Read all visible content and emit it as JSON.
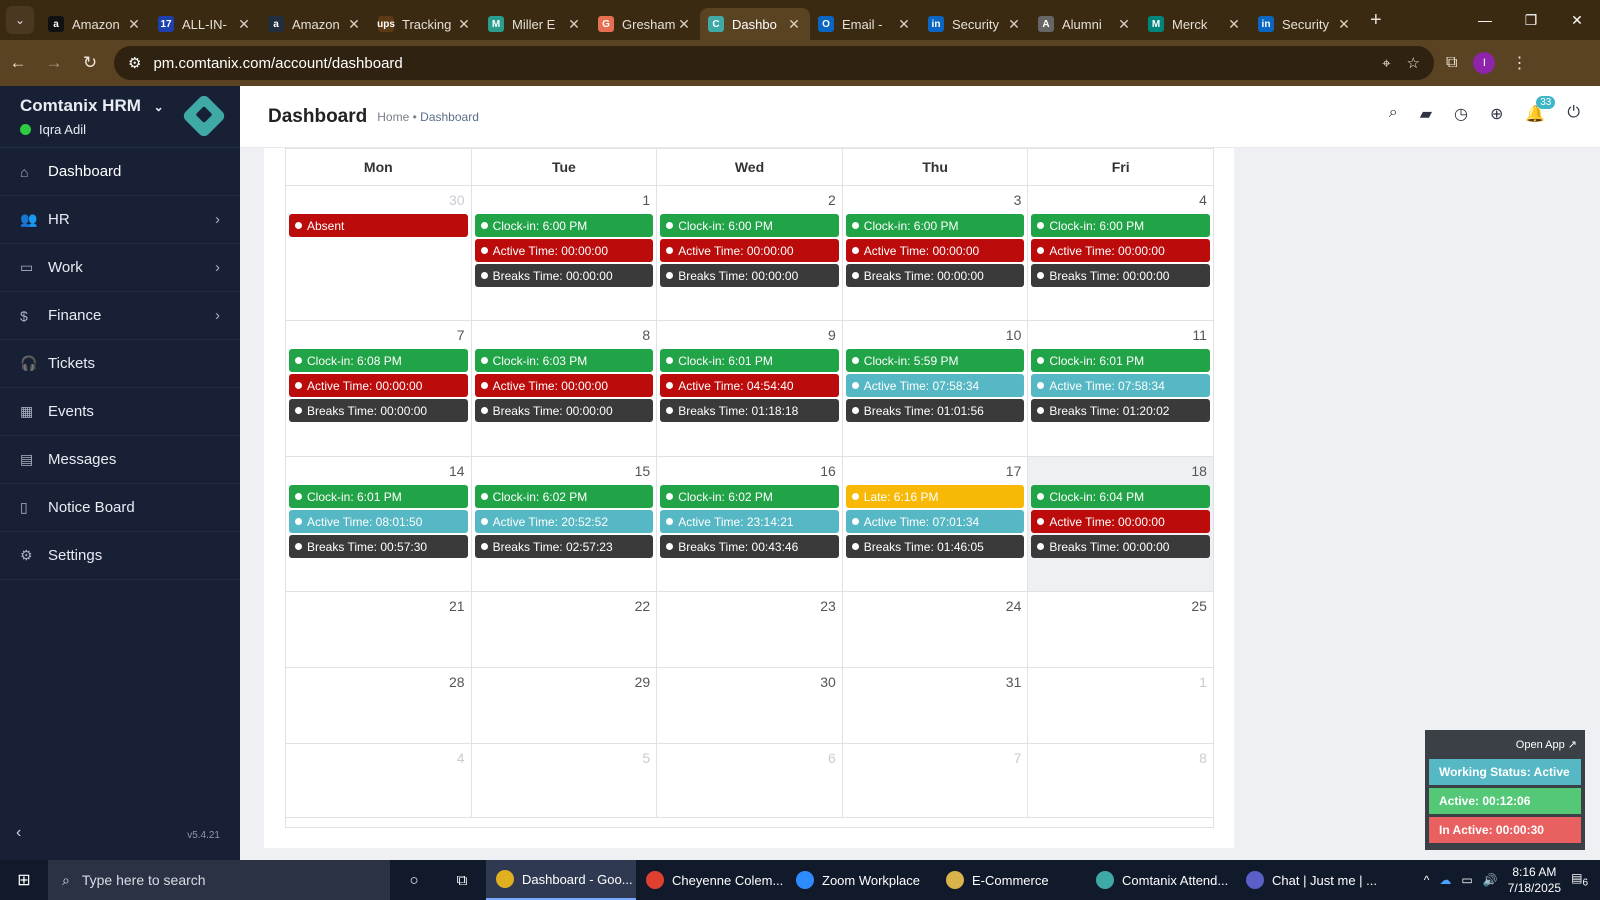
{
  "browser": {
    "tabs": [
      {
        "title": "Amazon",
        "color": "#111111",
        "glyph": "a"
      },
      {
        "title": "ALL-IN-",
        "color": "#1e40af",
        "glyph": "17"
      },
      {
        "title": "Amazon",
        "color": "#232f3e",
        "glyph": "a"
      },
      {
        "title": "Tracking",
        "color": "#5b3a16",
        "glyph": "ups"
      },
      {
        "title": "Miller E",
        "color": "#2a9d8f",
        "glyph": "M"
      },
      {
        "title": "Gresham",
        "color": "#e76f51",
        "glyph": "G"
      },
      {
        "title": "Dashbo",
        "color": "#3fa9a6",
        "glyph": "C"
      },
      {
        "title": "Email -",
        "color": "#0a66c2",
        "glyph": "O"
      },
      {
        "title": "Security",
        "color": "#0a66c2",
        "glyph": "in"
      },
      {
        "title": "Alumni",
        "color": "#666666",
        "glyph": "A"
      },
      {
        "title": "Merck",
        "color": "#00857c",
        "glyph": "M"
      },
      {
        "title": "Security",
        "color": "#0a66c2",
        "glyph": "in"
      }
    ],
    "active_tab_index": 6,
    "url": "pm.comtanix.com/account/dashboard",
    "profile_initial": "I"
  },
  "sidebar": {
    "brand": "Comtanix HRM",
    "user": "Iqra Adil",
    "items": [
      {
        "label": "Dashboard",
        "icon": "⌂",
        "has_children": false
      },
      {
        "label": "HR",
        "icon": "👥",
        "has_children": true
      },
      {
        "label": "Work",
        "icon": "▭",
        "has_children": true
      },
      {
        "label": "Finance",
        "icon": "$",
        "has_children": true
      },
      {
        "label": "Tickets",
        "icon": "🎧",
        "has_children": false
      },
      {
        "label": "Events",
        "icon": "▦",
        "has_children": false
      },
      {
        "label": "Messages",
        "icon": "▤",
        "has_children": false
      },
      {
        "label": "Notice Board",
        "icon": "▯",
        "has_children": false
      },
      {
        "label": "Settings",
        "icon": "⚙",
        "has_children": false
      }
    ],
    "version": "v5.4.21"
  },
  "header": {
    "title": "Dashboard",
    "breadcrumb_home": "Home",
    "breadcrumb_sep": "•",
    "breadcrumb_current": "Dashboard",
    "notification_count": "33"
  },
  "calendar": {
    "weekdays": [
      "Mon",
      "Tue",
      "Wed",
      "Thu",
      "Fri"
    ],
    "weeks": [
      {
        "height": 135,
        "days": [
          {
            "num": "30",
            "muted": true,
            "events": [
              {
                "type": "red",
                "text": "Absent"
              }
            ]
          },
          {
            "num": "1",
            "events": [
              {
                "type": "green",
                "text": "Clock-in: 6:00 PM"
              },
              {
                "type": "red",
                "text": "Active Time: 00:00:00"
              },
              {
                "type": "dark",
                "text": "Breaks Time: 00:00:00"
              }
            ]
          },
          {
            "num": "2",
            "events": [
              {
                "type": "green",
                "text": "Clock-in: 6:00 PM"
              },
              {
                "type": "red",
                "text": "Active Time: 00:00:00"
              },
              {
                "type": "dark",
                "text": "Breaks Time: 00:00:00"
              }
            ]
          },
          {
            "num": "3",
            "events": [
              {
                "type": "green",
                "text": "Clock-in: 6:00 PM"
              },
              {
                "type": "red",
                "text": "Active Time: 00:00:00"
              },
              {
                "type": "dark",
                "text": "Breaks Time: 00:00:00"
              }
            ]
          },
          {
            "num": "4",
            "events": [
              {
                "type": "green",
                "text": "Clock-in: 6:00 PM"
              },
              {
                "type": "red",
                "text": "Active Time: 00:00:00"
              },
              {
                "type": "dark",
                "text": "Breaks Time: 00:00:00"
              }
            ]
          }
        ]
      },
      {
        "height": 136,
        "days": [
          {
            "num": "7",
            "events": [
              {
                "type": "green",
                "text": "Clock-in: 6:08 PM"
              },
              {
                "type": "red",
                "text": "Active Time: 00:00:00"
              },
              {
                "type": "dark",
                "text": "Breaks Time: 00:00:00"
              }
            ]
          },
          {
            "num": "8",
            "events": [
              {
                "type": "green",
                "text": "Clock-in: 6:03 PM"
              },
              {
                "type": "red",
                "text": "Active Time: 00:00:00"
              },
              {
                "type": "dark",
                "text": "Breaks Time: 00:00:00"
              }
            ]
          },
          {
            "num": "9",
            "events": [
              {
                "type": "green",
                "text": "Clock-in: 6:01 PM"
              },
              {
                "type": "red",
                "text": "Active Time: 04:54:40"
              },
              {
                "type": "dark",
                "text": "Breaks Time: 01:18:18"
              }
            ]
          },
          {
            "num": "10",
            "events": [
              {
                "type": "green",
                "text": "Clock-in: 5:59 PM"
              },
              {
                "type": "teal",
                "text": "Active Time: 07:58:34"
              },
              {
                "type": "dark",
                "text": "Breaks Time: 01:01:56"
              }
            ]
          },
          {
            "num": "11",
            "events": [
              {
                "type": "green",
                "text": "Clock-in: 6:01 PM"
              },
              {
                "type": "teal",
                "text": "Active Time: 07:58:34"
              },
              {
                "type": "dark",
                "text": "Breaks Time: 01:20:02"
              }
            ]
          }
        ]
      },
      {
        "height": 135,
        "days": [
          {
            "num": "14",
            "events": [
              {
                "type": "green",
                "text": "Clock-in: 6:01 PM"
              },
              {
                "type": "teal",
                "text": "Active Time: 08:01:50"
              },
              {
                "type": "dark",
                "text": "Breaks Time: 00:57:30"
              }
            ]
          },
          {
            "num": "15",
            "events": [
              {
                "type": "green",
                "text": "Clock-in: 6:02 PM"
              },
              {
                "type": "teal",
                "text": "Active Time: 20:52:52"
              },
              {
                "type": "dark",
                "text": "Breaks Time: 02:57:23"
              }
            ]
          },
          {
            "num": "16",
            "events": [
              {
                "type": "green",
                "text": "Clock-in: 6:02 PM"
              },
              {
                "type": "teal",
                "text": "Active Time: 23:14:21"
              },
              {
                "type": "dark",
                "text": "Breaks Time: 00:43:46"
              }
            ]
          },
          {
            "num": "17",
            "events": [
              {
                "type": "yellow",
                "text": "Late: 6:16 PM"
              },
              {
                "type": "teal",
                "text": "Active Time: 07:01:34"
              },
              {
                "type": "dark",
                "text": "Breaks Time: 01:46:05"
              }
            ]
          },
          {
            "num": "18",
            "today": true,
            "events": [
              {
                "type": "green",
                "text": "Clock-in: 6:04 PM"
              },
              {
                "type": "red",
                "text": "Active Time: 00:00:00"
              },
              {
                "type": "dark",
                "text": "Breaks Time: 00:00:00"
              }
            ]
          }
        ]
      },
      {
        "height": 76,
        "days": [
          {
            "num": "21",
            "events": []
          },
          {
            "num": "22",
            "events": []
          },
          {
            "num": "23",
            "events": []
          },
          {
            "num": "24",
            "events": []
          },
          {
            "num": "25",
            "events": []
          }
        ]
      },
      {
        "height": 76,
        "days": [
          {
            "num": "28",
            "events": []
          },
          {
            "num": "29",
            "events": []
          },
          {
            "num": "30",
            "events": []
          },
          {
            "num": "31",
            "events": []
          },
          {
            "num": "1",
            "muted": true,
            "events": []
          }
        ]
      },
      {
        "height": 74,
        "days": [
          {
            "num": "4",
            "muted": true,
            "events": []
          },
          {
            "num": "5",
            "muted": true,
            "events": []
          },
          {
            "num": "6",
            "muted": true,
            "events": []
          },
          {
            "num": "7",
            "muted": true,
            "events": []
          },
          {
            "num": "8",
            "muted": true,
            "events": []
          }
        ]
      }
    ]
  },
  "widget": {
    "open_app": "Open App ↗",
    "working_status": "Working Status: Active",
    "active": "Active: 00:12:06",
    "inactive": "In Active: 00:00:30"
  },
  "taskbar": {
    "search_placeholder": "Type here to search",
    "apps": [
      {
        "label": "Dashboard - Goo...",
        "color": "#e0b020",
        "active": true
      },
      {
        "label": "Cheyenne Colem...",
        "color": "#e04030",
        "active": false
      },
      {
        "label": "Zoom Workplace",
        "color": "#2d8cff",
        "active": false
      },
      {
        "label": "E-Commerce",
        "color": "#d9b44a",
        "active": false
      },
      {
        "label": "Comtanix Attend...",
        "color": "#3fa9a6",
        "active": false
      },
      {
        "label": "Chat | Just me | ...",
        "color": "#5b5fc7",
        "active": false
      }
    ],
    "time": "8:16 AM",
    "date": "7/18/2025",
    "notif_count": "6"
  },
  "colors": {
    "sidebar_bg": "#172035",
    "clockin_green": "#21a447",
    "active_red": "#bb0b0b",
    "active_teal": "#55b8c4",
    "breaks_dark": "#3a3a3a",
    "late_yellow": "#f8b906"
  }
}
